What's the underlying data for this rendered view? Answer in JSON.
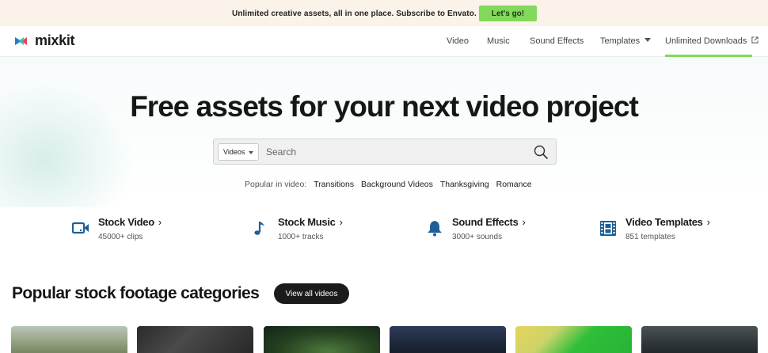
{
  "promo": {
    "text": "Unlimited creative assets, all in one place. Subscribe to Envato.",
    "button_label": "Let's go!"
  },
  "header": {
    "logo_text": "mixkit",
    "nav": [
      {
        "label": "Video"
      },
      {
        "label": "Music"
      },
      {
        "label": "Sound Effects"
      },
      {
        "label": "Templates"
      },
      {
        "label": "Unlimited Downloads"
      }
    ]
  },
  "hero": {
    "title": "Free assets for your next video project",
    "search": {
      "type_selected": "Videos",
      "placeholder": "Search"
    },
    "popular": {
      "label": "Popular in video:",
      "tags": [
        "Transitions",
        "Background Videos",
        "Thanksgiving",
        "Romance"
      ]
    }
  },
  "categories": [
    {
      "title": "Stock Video",
      "subtitle": "45000+ clips",
      "icon": "video-camera-icon"
    },
    {
      "title": "Stock Music",
      "subtitle": "1000+ tracks",
      "icon": "music-note-icon"
    },
    {
      "title": "Sound Effects",
      "subtitle": "3000+ sounds",
      "icon": "bell-icon"
    },
    {
      "title": "Video Templates",
      "subtitle": "851 templates",
      "icon": "film-strip-icon"
    }
  ],
  "section": {
    "title": "Popular stock footage categories",
    "view_all_label": "View all videos"
  },
  "colors": {
    "accent_green": "#82d95b",
    "icon_blue": "#1f5f99",
    "promo_bg": "#fbf2e9",
    "dark_button": "#1b1b1b"
  }
}
